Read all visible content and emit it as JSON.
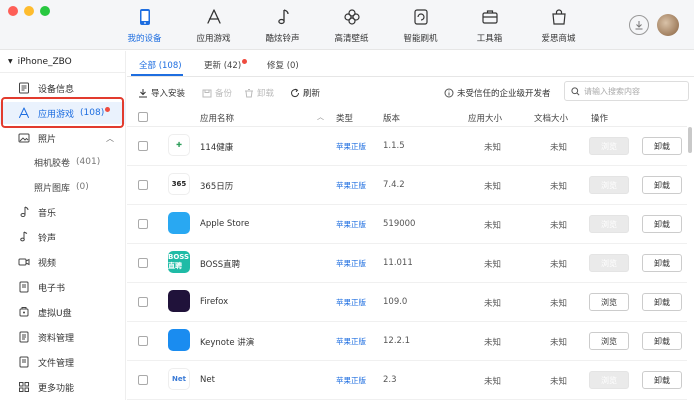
{
  "nav": [
    {
      "label": "我的设备",
      "icon": "phone-icon",
      "active": true
    },
    {
      "label": "应用游戏",
      "icon": "app-store-icon"
    },
    {
      "label": "酷炫铃声",
      "icon": "music-note-icon"
    },
    {
      "label": "高清壁纸",
      "icon": "flower-icon"
    },
    {
      "label": "智能刷机",
      "icon": "refresh-icon"
    },
    {
      "label": "工具箱",
      "icon": "toolbox-icon"
    },
    {
      "label": "爱思商城",
      "icon": "shop-icon"
    }
  ],
  "sidebar": {
    "device": "iPhone_ZBO",
    "items": [
      {
        "label": "设备信息",
        "icon": "device-info-icon"
      },
      {
        "label": "应用游戏",
        "count": "(108)",
        "icon": "app-store-icon",
        "active": true
      },
      {
        "label": "照片",
        "icon": "photo-icon"
      },
      {
        "label": "相机胶卷",
        "count": "(401)"
      },
      {
        "label": "照片图库",
        "count": "(0)"
      },
      {
        "label": "音乐",
        "icon": "music-icon"
      },
      {
        "label": "铃声",
        "icon": "bell-icon"
      },
      {
        "label": "视频",
        "icon": "video-icon"
      },
      {
        "label": "电子书",
        "icon": "book-icon"
      },
      {
        "label": "虚拟U盘",
        "icon": "usb-icon"
      },
      {
        "label": "资料管理",
        "icon": "contacts-icon"
      },
      {
        "label": "文件管理",
        "icon": "folder-icon"
      },
      {
        "label": "更多功能",
        "icon": "grid-icon"
      }
    ]
  },
  "tabs": [
    {
      "label": "全部 (108)"
    },
    {
      "label": "更新 (42)"
    },
    {
      "label": "修复 (0)"
    }
  ],
  "toolbar": {
    "import": "导入安装",
    "backup": "备份",
    "uninstall": "卸载",
    "refresh": "刷新",
    "untrusted": "未受信任的企业级开发者",
    "search_placeholder": "请输入搜索内容"
  },
  "table": {
    "headers": [
      "应用名称",
      "类型",
      "版本",
      "应用大小",
      "文档大小",
      "操作"
    ],
    "rows": [
      {
        "name": "114健康",
        "type": "苹果正版",
        "version": "1.1.5",
        "app_size": "未知",
        "doc_size": "未知",
        "browse": "浏览",
        "uninstall": "卸载",
        "browse_enabled": false,
        "icon_bg": "#ffffff",
        "icon_text": "✚",
        "icon_color": "#2e9d5a"
      },
      {
        "name": "365日历",
        "type": "苹果正版",
        "version": "7.4.2",
        "app_size": "未知",
        "doc_size": "未知",
        "browse": "浏览",
        "uninstall": "卸载",
        "browse_enabled": false,
        "icon_bg": "#ffffff",
        "icon_text": "365",
        "icon_color": "#222222"
      },
      {
        "name": "Apple Store",
        "type": "苹果正版",
        "version": "519000",
        "app_size": "未知",
        "doc_size": "未知",
        "browse": "浏览",
        "uninstall": "卸载",
        "browse_enabled": false,
        "icon_bg": "#29a8f2",
        "icon_text": "",
        "icon_color": "#ffffff"
      },
      {
        "name": "BOSS直聘",
        "type": "苹果正版",
        "version": "11.011",
        "app_size": "未知",
        "doc_size": "未知",
        "browse": "浏览",
        "uninstall": "卸载",
        "browse_enabled": false,
        "icon_bg": "#1fbba6",
        "icon_text": "BOSS 直聘",
        "icon_color": "#ffffff"
      },
      {
        "name": "Firefox",
        "type": "苹果正版",
        "version": "109.0",
        "app_size": "未知",
        "doc_size": "未知",
        "browse": "浏览",
        "uninstall": "卸载",
        "browse_enabled": true,
        "icon_bg": "#20123a",
        "icon_text": "",
        "icon_color": "#ff7139"
      },
      {
        "name": "Keynote 讲演",
        "type": "苹果正版",
        "version": "12.2.1",
        "app_size": "未知",
        "doc_size": "未知",
        "browse": "浏览",
        "uninstall": "卸载",
        "browse_enabled": true,
        "icon_bg": "#1a8cf0",
        "icon_text": "",
        "icon_color": "#ffffff"
      },
      {
        "name": "Net",
        "type": "苹果正版",
        "version": "2.3",
        "app_size": "未知",
        "doc_size": "未知",
        "browse": "浏览",
        "uninstall": "卸载",
        "browse_enabled": false,
        "icon_bg": "#ffffff",
        "icon_text": "Net",
        "icon_color": "#3b7bd6"
      }
    ]
  },
  "colors": {
    "accent": "#1e6ee0",
    "highlight": "#e23b2e",
    "badge": "#ef4b3f"
  }
}
